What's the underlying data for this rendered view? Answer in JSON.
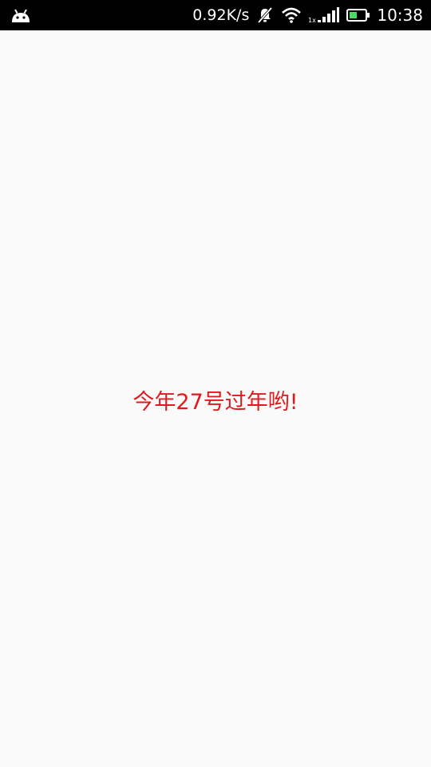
{
  "status_bar": {
    "net_speed": "0.92K/s",
    "time": "10:38",
    "signal_label": "1x",
    "icons": [
      "android-notification-icon",
      "mute-icon",
      "wifi-icon",
      "signal-icon",
      "battery-icon"
    ],
    "battery_color": "#4cd964"
  },
  "main": {
    "message": "今年27号过年哟!",
    "message_color": "#e0191c"
  }
}
